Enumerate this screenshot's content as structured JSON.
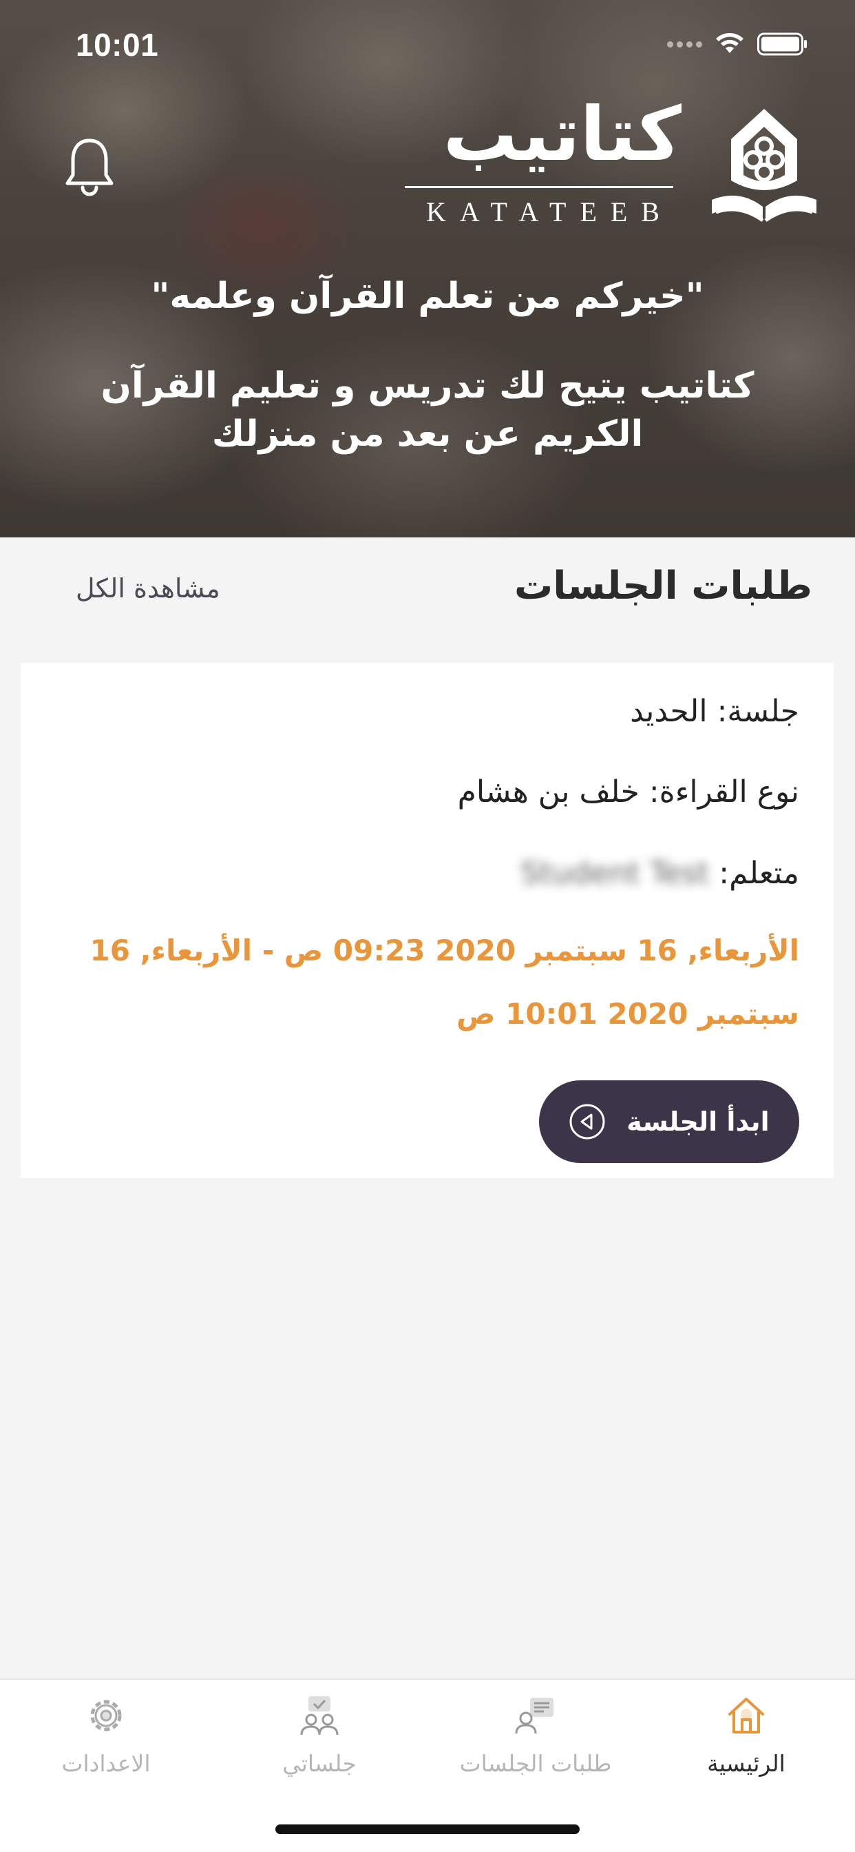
{
  "status_bar": {
    "time": "10:01"
  },
  "header": {
    "logo_arabic": "كتاتيب",
    "logo_latin": "KATATEEB",
    "quote": "\"خيركم من تعلم القرآن وعلمه\"",
    "tagline": "كتاتيب يتيح لك تدريس و تعليم القرآن الكريم عن بعد من منزلك"
  },
  "section": {
    "title": "طلبات الجلسات",
    "view_all": "مشاهدة الكل"
  },
  "card": {
    "session_label": "جلسة:",
    "session_value": "الحديد",
    "reading_label": "نوع القراءة:",
    "reading_value": "خلف بن هشام",
    "student_label": "متعلم:",
    "student_value": "Student Test",
    "dates": "الأربعاء, 16 سبتمبر 2020 09:23 ص - الأربعاء, 16 سبتمبر 2020 10:01 ص",
    "start_button": "ابدأ الجلسة"
  },
  "tabs": [
    {
      "label": "الرئيسية",
      "icon": "home-icon",
      "active": true
    },
    {
      "label": "طلبات الجلسات",
      "icon": "requests-icon",
      "active": false
    },
    {
      "label": "جلساتي",
      "icon": "sessions-icon",
      "active": false
    },
    {
      "label": "الاعدادات",
      "icon": "gear-icon",
      "active": false
    }
  ],
  "colors": {
    "accent_orange": "#e9953a",
    "button_dark": "#3c3448",
    "background": "#f4f4f4"
  }
}
